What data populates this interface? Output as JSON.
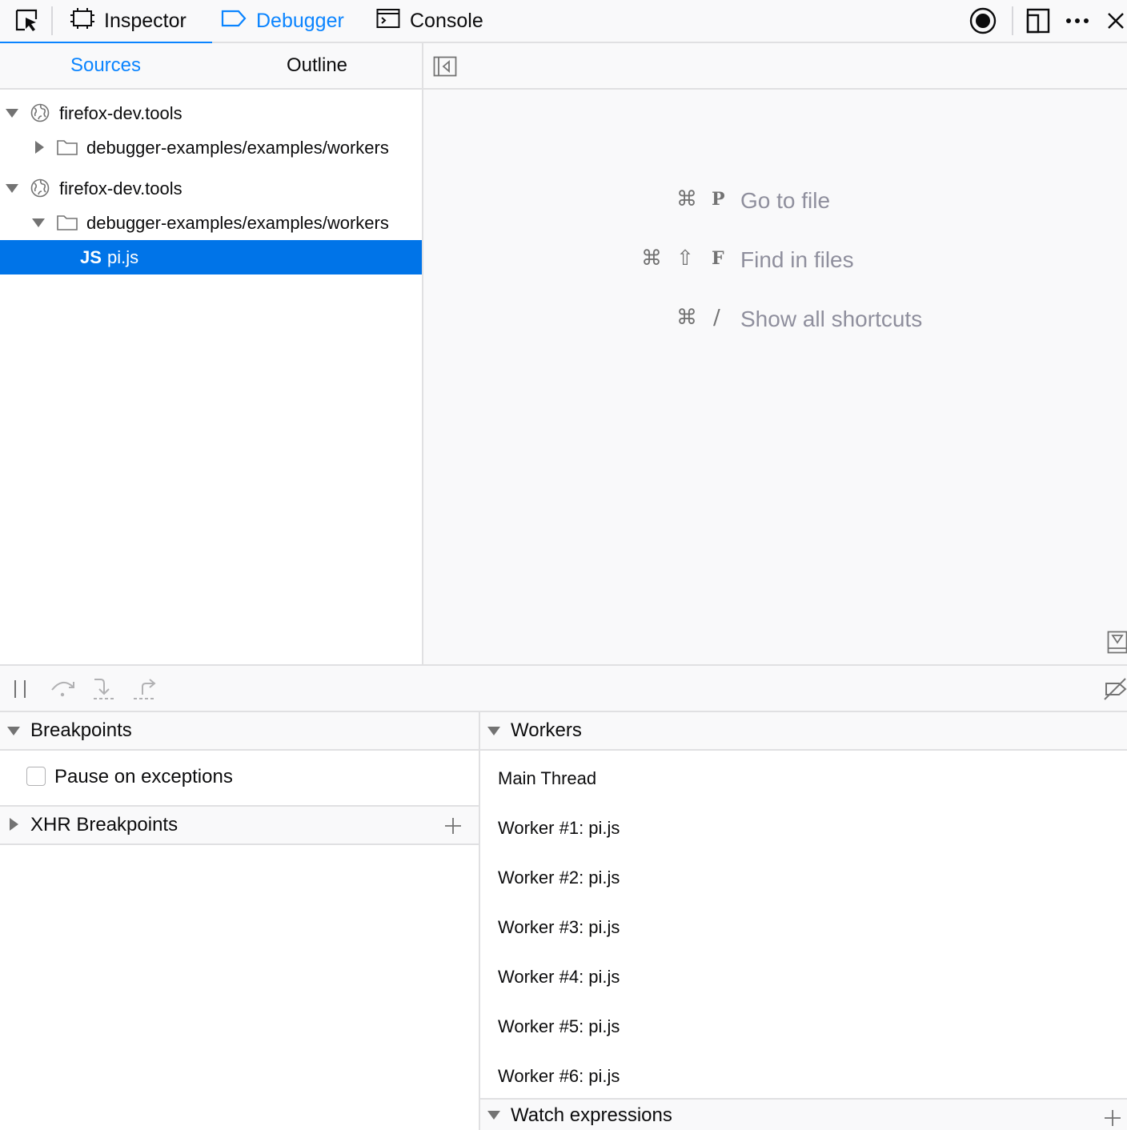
{
  "toolbar": {
    "tabs": [
      {
        "label": "Inspector",
        "icon": "inspector-icon"
      },
      {
        "label": "Debugger",
        "icon": "debugger-icon",
        "active": true
      },
      {
        "label": "Console",
        "icon": "console-icon"
      }
    ],
    "right_icons": [
      "record-icon",
      "dock-side-icon",
      "more-options-icon",
      "close-icon"
    ]
  },
  "left_panel": {
    "tabs": [
      {
        "label": "Sources",
        "active": true
      },
      {
        "label": "Outline",
        "active": false
      }
    ],
    "tree": [
      {
        "label": "firefox-dev.tools",
        "icon": "globe-icon",
        "expanded": true
      },
      {
        "label": "debugger-examples/examples/workers",
        "icon": "folder-icon",
        "expanded": false
      },
      {
        "label": "firefox-dev.tools",
        "icon": "globe-icon",
        "expanded": true
      },
      {
        "label": "debugger-examples/examples/workers",
        "icon": "folder-icon",
        "expanded": true
      },
      {
        "label": "pi.js",
        "badge": "JS",
        "selected": true
      }
    ]
  },
  "editor": {
    "shortcuts": [
      {
        "keys": [
          "⌘",
          "P"
        ],
        "label": "Go to file"
      },
      {
        "keys": [
          "⌘",
          "⇧",
          "F"
        ],
        "label": "Find in files"
      },
      {
        "keys": [
          "⌘",
          "/"
        ],
        "label": "Show all shortcuts"
      }
    ]
  },
  "breakpoints": {
    "header": "Breakpoints",
    "pause_on_exceptions": "Pause on exceptions",
    "xhr_header": "XHR Breakpoints"
  },
  "workers": {
    "header": "Workers",
    "items": [
      "Main Thread",
      "Worker #1: pi.js",
      "Worker #2: pi.js",
      "Worker #3: pi.js",
      "Worker #4: pi.js",
      "Worker #5: pi.js",
      "Worker #6: pi.js"
    ],
    "watch_header": "Watch expressions"
  },
  "colors": {
    "accent": "#0a84ff",
    "selection": "#0074e8"
  }
}
